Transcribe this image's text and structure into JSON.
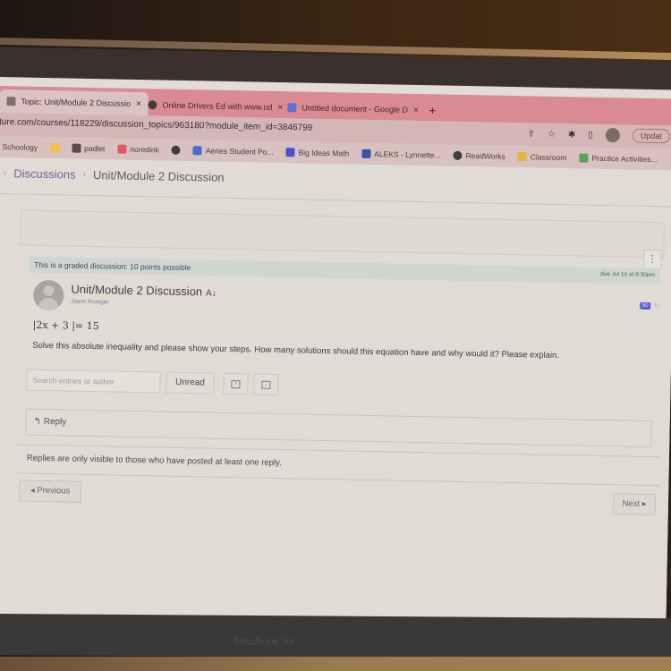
{
  "browser": {
    "tabs": [
      {
        "label": "Topic: Unit/Module 2 Discussio",
        "icon": "canvas-icon",
        "active": true
      },
      {
        "label": "Online Drivers Ed with www.ud",
        "icon": "globe-icon",
        "active": false
      },
      {
        "label": "Untitled document - Google D",
        "icon": "docs-icon",
        "active": false
      }
    ],
    "new_tab": "+",
    "close_glyph": "×",
    "url": "ture.com/courses/118229/discussion_topics/963180?module_item_id=3846799",
    "update_label": "Updat",
    "bookmarks": [
      {
        "label": "Schoology",
        "color": "#c9b3b3"
      },
      {
        "label": "",
        "color": "#f3c146"
      },
      {
        "label": "padlet",
        "color": "#5a4a4a"
      },
      {
        "label": "noredink",
        "color": "#e05a66"
      },
      {
        "label": "",
        "color": "#3e3e3e"
      },
      {
        "label": "Aeries Student Po...",
        "color": "#4b6cc8"
      },
      {
        "label": "Big Ideas Math",
        "color": "#4e4fd0"
      },
      {
        "label": "ALEKS - Lynnette...",
        "color": "#3a53a8"
      },
      {
        "label": "ReadWorks",
        "color": "#3e3e3e"
      },
      {
        "label": "Classroom",
        "color": "#e2b63c"
      },
      {
        "label": "Practice Activities...",
        "color": "#5aa35a"
      }
    ]
  },
  "breadcrumb": {
    "items": [
      "Discussions",
      "Unit/Module 2 Discussion"
    ],
    "separator": "›"
  },
  "discussion": {
    "graded_notice": "This is a graded discussion: 10 points possible",
    "due": "due Jul 14 at 8:30pm",
    "title": "Unit/Module 2 Discussion",
    "subscribe_icon": "A↓",
    "author": "Jason Krueger",
    "badge_value": "50",
    "badge_muted": "50",
    "equation": "|2x + 3 |= 15",
    "question": "Solve this absolute inequality and please show your steps. How many solutions should this equation have and why would it? Please explain.",
    "kebab": "⋮"
  },
  "controls": {
    "search_placeholder": "Search entries or author",
    "unread_label": "Unread",
    "expand_glyph": "↑",
    "collapse_glyph": "↓"
  },
  "reply": {
    "label": "↰ Reply"
  },
  "replies_note": "Replies are only visible to those who have posted at least one reply.",
  "pagination": {
    "previous": "◂ Previous",
    "next": "Next ▸"
  },
  "device": {
    "label": "MacBook Air"
  }
}
